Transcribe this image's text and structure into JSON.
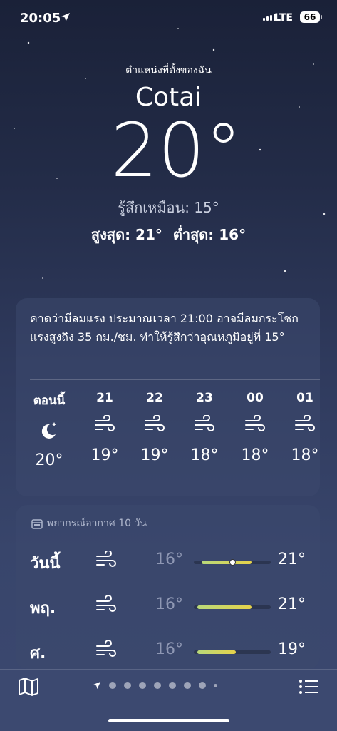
{
  "status": {
    "time": "20:05",
    "network": "LTE",
    "battery": "66"
  },
  "header": {
    "location_label": "ตำแหน่งที่ตั้งของฉัน",
    "city": "Cotai",
    "temperature": "20°",
    "feels_like": "รู้สึกเหมือน: 15°",
    "high": "สูงสุด: 21°",
    "low": "ต่ำสุด: 16°"
  },
  "alert_card": {
    "description": "คาดว่ามีลมแรง ประมาณเวลา 21:00 อาจมีลมกระโชกแรงสูงถึง 35 กม./ชม. ทำให้รู้สึกว่าอุณหภูมิอยู่ที่ 15°",
    "hours": [
      {
        "label": "ตอนนี้",
        "icon": "moon-stars-icon",
        "temp": "20°"
      },
      {
        "label": "21",
        "icon": "wind-icon",
        "temp": "19°"
      },
      {
        "label": "22",
        "icon": "wind-icon",
        "temp": "19°"
      },
      {
        "label": "23",
        "icon": "wind-icon",
        "temp": "18°"
      },
      {
        "label": "00",
        "icon": "wind-icon",
        "temp": "18°"
      },
      {
        "label": "01",
        "icon": "wind-icon",
        "temp": "18°"
      }
    ]
  },
  "forecast": {
    "title": "พยากรณ์อากาศ 10 วัน",
    "days": [
      {
        "name": "วันนี้",
        "icon": "wind-icon",
        "low": "16°",
        "high": "21°",
        "range_start": 0.1,
        "range_end": 0.75,
        "current": 0.5
      },
      {
        "name": "พฤ.",
        "icon": "wind-icon",
        "low": "16°",
        "high": "21°",
        "range_start": 0.05,
        "range_end": 0.75
      },
      {
        "name": "ศ.",
        "icon": "wind-icon",
        "low": "16°",
        "high": "19°",
        "range_start": 0.05,
        "range_end": 0.55
      }
    ]
  },
  "bottom_bar": {
    "page_count": 9,
    "current_page": 0
  },
  "colors": {
    "accent_bar": "#e6d24a",
    "background": "#2f3a5d"
  }
}
